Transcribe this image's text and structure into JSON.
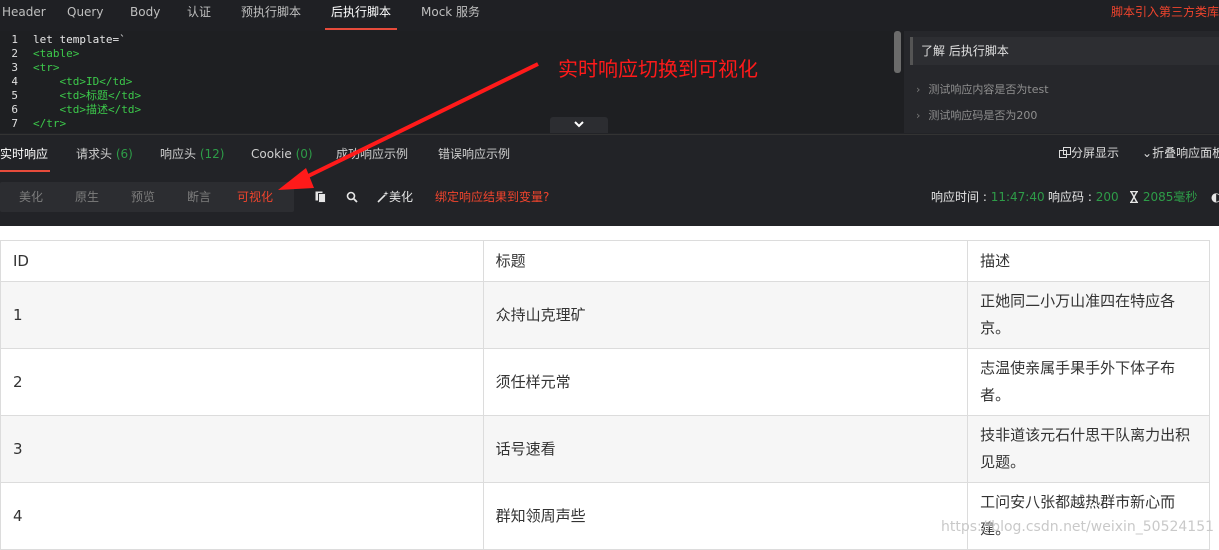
{
  "top_tabs": [
    {
      "label": "Header"
    },
    {
      "label": "Query"
    },
    {
      "label": "Body"
    },
    {
      "label": "认证"
    },
    {
      "label": "预执行脚本"
    },
    {
      "label": "后执行脚本"
    },
    {
      "label": "Mock 服务"
    }
  ],
  "top_tip": "脚本引入第三方类库",
  "editor": {
    "line_numbers": [
      "1",
      "2",
      "3",
      "4",
      "5",
      "6",
      "7"
    ],
    "lines": [
      {
        "text": "let template=`",
        "color": "#e8e8e8"
      },
      {
        "text": "<table>",
        "color": "#3cc94b"
      },
      {
        "text": "<tr>",
        "color": "#3cc94b"
      },
      {
        "text": "    <td>ID</td>",
        "color": "#3cc94b"
      },
      {
        "text": "    <td>标题</td>",
        "color": "#3cc94b"
      },
      {
        "text": "    <td>描述</td>",
        "color": "#3cc94b"
      },
      {
        "text": "</tr>",
        "color": "#3cc94b"
      }
    ],
    "collapse_icon": "chevron-down-icon"
  },
  "help_panel": {
    "title": "了解 后执行脚本",
    "items": [
      "测试响应内容是否为test",
      "测试响应码是否为200"
    ]
  },
  "annotation": "实时响应切换到可视化",
  "response_tabs": {
    "live": "实时响应",
    "req_headers": "请求头",
    "req_headers_count": "(6)",
    "resp_headers": "响应头",
    "resp_headers_count": "(12)",
    "cookie": "Cookie",
    "cookie_count": "(0)",
    "success_example": "成功响应示例",
    "error_example": "错误响应示例",
    "fullscreen": "分屏显示",
    "collapse": "折叠响应面板"
  },
  "format_bar": {
    "modes": [
      "美化",
      "原生",
      "预览",
      "断言",
      "可视化"
    ],
    "active": "可视化",
    "beautify_label": "美化",
    "bind_link": "绑定响应结果到变量?",
    "response_time_label": "响应时间 :",
    "response_time_value": "11:47:40",
    "status_label": "响应码 :",
    "status_value": "200",
    "duration_value": "2085毫秒"
  },
  "table": {
    "headers": [
      "ID",
      "标题",
      "描述"
    ],
    "rows": [
      [
        "1",
        "众持山克理矿",
        "正她同二小万山准四在特应各京。"
      ],
      [
        "2",
        "须任样元常",
        "志温使亲属手果手外下体子布者。"
      ],
      [
        "3",
        "话号速看",
        "技非道该元石什思干队离力出积见题。"
      ],
      [
        "4",
        "群知领周声些",
        "工问安八张都越热群市新心而建。"
      ]
    ]
  },
  "watermark": "https://blog.csdn.net/weixin_50524151"
}
